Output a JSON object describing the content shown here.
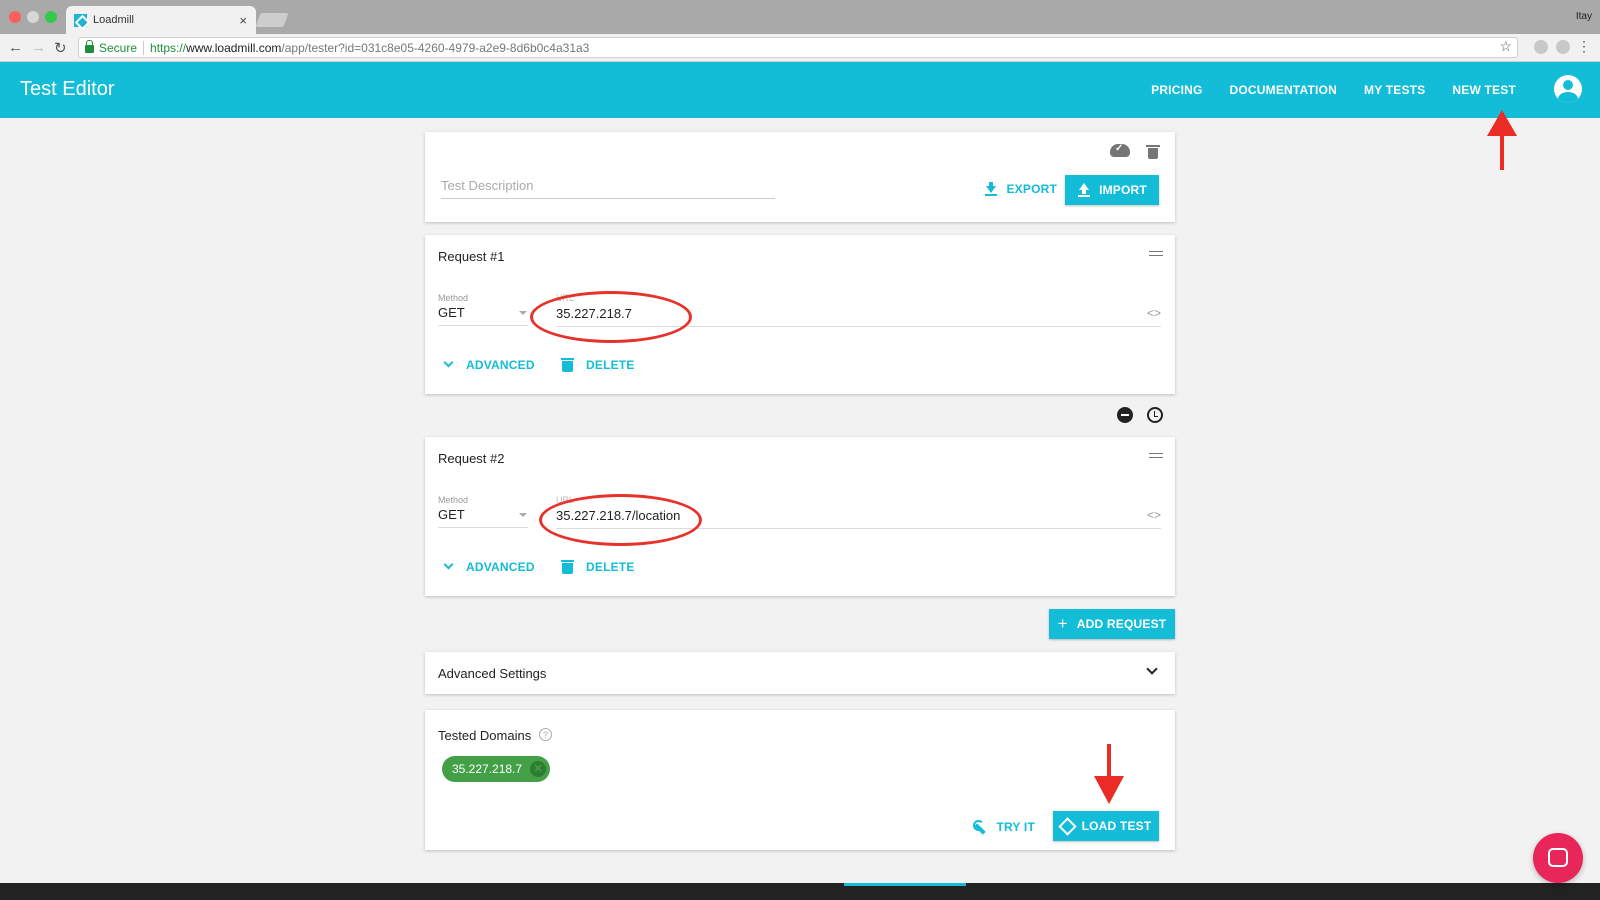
{
  "browser": {
    "tab_title": "Loadmill",
    "tab_close": "×",
    "user": "Itay",
    "secure_label": "Secure",
    "url_proto": "https://",
    "url_host": "www.loadmill.com",
    "url_path": "/app/tester?id=031c8e05-4260-4979-a2e9-8d6b0c4a31a3"
  },
  "header": {
    "title": "Test Editor",
    "nav": [
      "PRICING",
      "DOCUMENTATION",
      "MY TESTS",
      "NEW TEST"
    ]
  },
  "description": {
    "placeholder": "Test Description",
    "export_label": "EXPORT",
    "import_label": "IMPORT"
  },
  "requests": [
    {
      "title": "Request #1",
      "method_label": "Method",
      "method": "GET",
      "url_label": "URL",
      "url": "35.227.218.7",
      "advanced_label": "ADVANCED",
      "delete_label": "DELETE"
    },
    {
      "title": "Request #2",
      "method_label": "Method",
      "method": "GET",
      "url_label": "URL",
      "url": "35.227.218.7/location",
      "advanced_label": "ADVANCED",
      "delete_label": "DELETE"
    }
  ],
  "add_request_label": "ADD REQUEST",
  "advanced_settings": {
    "title": "Advanced Settings"
  },
  "tested_domains": {
    "title": "Tested Domains",
    "help": "?",
    "chips": [
      "35.227.218.7"
    ],
    "try_it_label": "TRY IT",
    "load_test_label": "LOAD TEST"
  },
  "colors": {
    "accent": "#13bcd7",
    "chip": "#43a047",
    "annotation": "#ea2b26",
    "chat": "#e8265a"
  }
}
